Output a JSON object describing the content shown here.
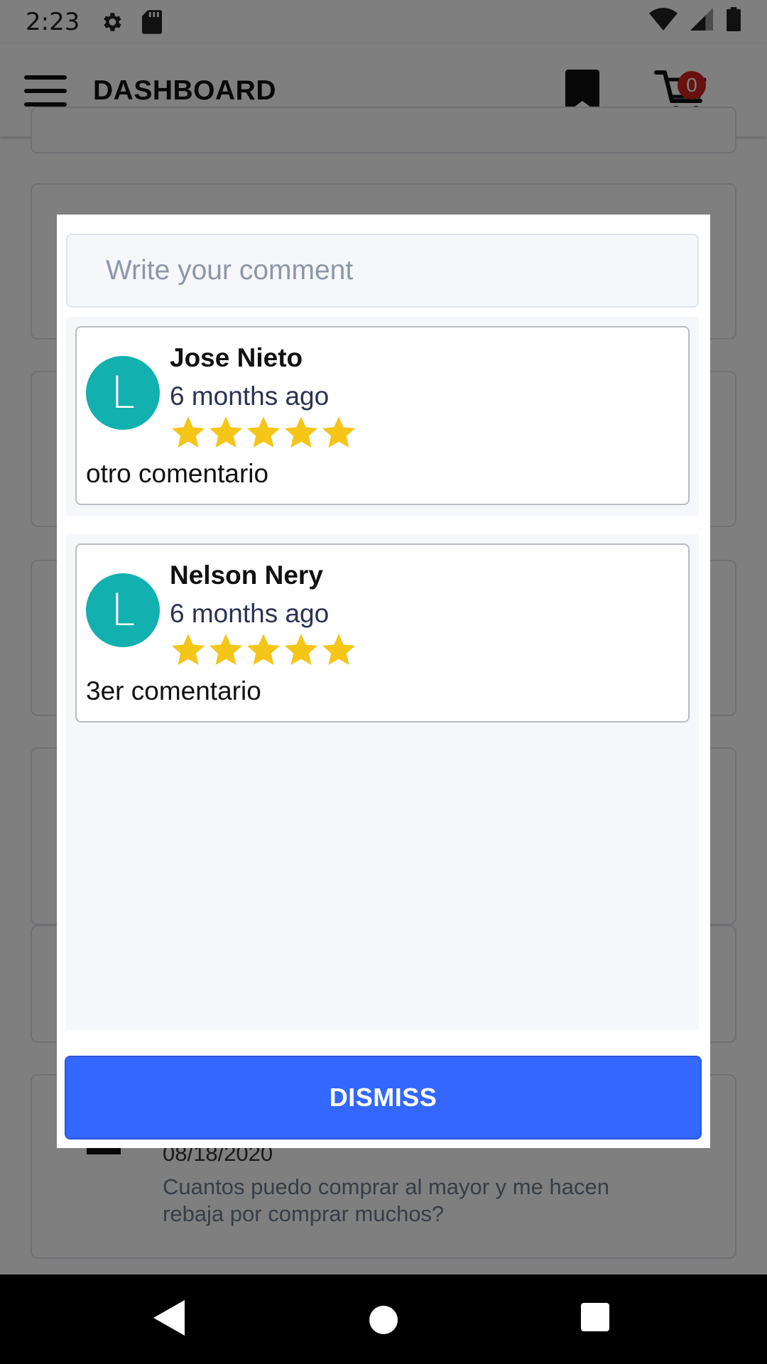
{
  "status_bar": {
    "time": "2:23",
    "icons": [
      "gear-icon",
      "sd-card-icon",
      "wifi-icon",
      "cell-signal-icon",
      "battery-icon"
    ]
  },
  "app_bar": {
    "title": "DASHBOARD",
    "cart_count": "0",
    "icons": [
      "menu-icon",
      "bookmark-icon",
      "cart-icon"
    ]
  },
  "background": {
    "question_date": "08/18/2020",
    "question_text": "Cuantos puedo comprar al mayor y me hacen rebaja por comprar muchos?"
  },
  "modal": {
    "comment_placeholder": "Write your comment",
    "comments": [
      {
        "avatar_letter": "L",
        "name": "Jose Nieto",
        "time": "6 months ago",
        "rating": 5,
        "text": "otro comentario"
      },
      {
        "avatar_letter": "L",
        "name": "Nelson Nery",
        "time": "6 months ago",
        "rating": 5,
        "text": "3er comentario"
      }
    ],
    "dismiss_label": "DISMISS"
  },
  "colors": {
    "accent": "#3467ff",
    "avatar": "#12b0ae",
    "star": "#f5c518",
    "badge": "#d32020"
  }
}
